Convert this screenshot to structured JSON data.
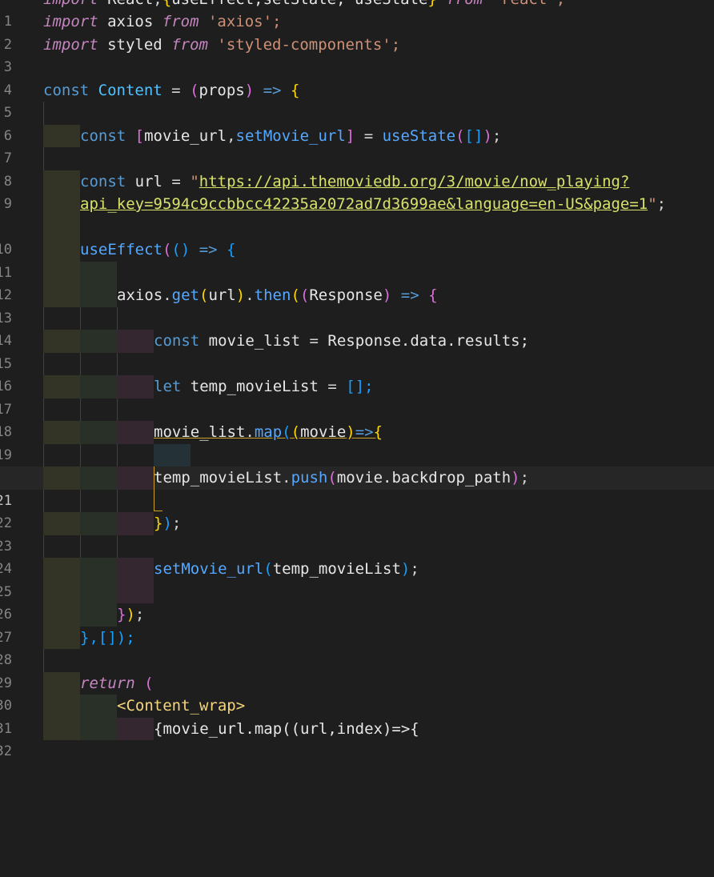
{
  "editor": {
    "line_numbers": [
      "1",
      "2",
      "3",
      "4",
      "5",
      "6",
      "7",
      "8",
      "9",
      "",
      "10",
      "11",
      "12",
      "13",
      "14",
      "15",
      "16",
      "17",
      "18",
      "19",
      "20",
      "21",
      "22",
      "23",
      "24",
      "25",
      "26",
      "27",
      "28",
      "29",
      "30",
      "31",
      "32"
    ],
    "current_line": "21",
    "lines": [
      {
        "import_kw": "import",
        "react_name": "React",
        "open": "{",
        "hooks": "useEffect,setState, useState",
        "close": "}",
        "from_kw": "from",
        "module": "'react';"
      },
      {
        "import_kw": "import",
        "name": "axios",
        "from_kw": "from",
        "module": "'axios';"
      },
      {
        "import_kw": "import",
        "name": "styled",
        "from_kw": "from",
        "module": "'styled-components';"
      },
      {},
      {
        "const_kw": "const",
        "name": "Content",
        "eq": " = ",
        "paren_open": "(",
        "param": "props",
        "paren_close": ")",
        "arrow": " => ",
        "brace": "{"
      },
      {},
      {
        "const_kw": "const",
        "bracket_open": "[",
        "a": "movie_url",
        "comma": ",",
        "b": "setMovie_url",
        "bracket_close": "]",
        "eq": " = ",
        "fn": "useState",
        "p_open": "(",
        "arr": "[]",
        "p_close": ")",
        "semi": ";"
      },
      {},
      {
        "const_kw": "const",
        "name": "url",
        "eq": " = ",
        "quote": "\"",
        "url_part1": "https://api.themoviedb.org/3/movie/now_playing?"
      },
      {
        "url_part2": "api_key=9594c9ccbbcc42235a2072ad7d3699ae&language=en-US&page=1",
        "quote_end": "\"",
        "semi": ";"
      },
      {},
      {
        "fn": "useEffect",
        "p_open": "(",
        "inner": "()",
        "arrow": " => ",
        "brace": "{"
      },
      {},
      {
        "obj": "axios",
        "dot": ".",
        "m1": "get",
        "p_open": "(",
        "arg": "url",
        "p_close": ")",
        "dot2": ".",
        "m2": "then",
        "p2_open": "(",
        "p3_open": "(",
        "param": "Response",
        "p3_close": ")",
        "arrow": " => ",
        "brace": "{"
      },
      {},
      {
        "const_kw": "const",
        "name": "movie_list",
        "eq": " = ",
        "value": "Response.data.results;"
      },
      {},
      {
        "let_kw": "let",
        "name": "temp_movieList",
        "eq": " = ",
        "value": "[];"
      },
      {},
      {
        "obj": "movie_list",
        "dot": ".",
        "m": "map",
        "p_open": "(",
        "p2_open": "(",
        "param": "movie",
        "p2_close": ")",
        "arrow": "=>",
        "brace": "{"
      },
      {},
      {
        "obj": "temp_movieList",
        "dot": ".",
        "m": "push",
        "p_open": "(",
        "arg": "movie.backdrop_path",
        "p_close": ")",
        "semi": ";"
      },
      {},
      {
        "brace": "}",
        "paren": ")",
        "semi": ";"
      },
      {},
      {
        "fn": "setMovie_url",
        "p_open": "(",
        "arg": "temp_movieList",
        "p_close": ")",
        "semi": ";"
      },
      {},
      {
        "brace": "}",
        "paren": ")",
        "semi": ";"
      },
      {
        "text": "},[]);"
      },
      {},
      {
        "kw": "return",
        "paren": " ("
      },
      {
        "tag": "<Content_wrap>"
      },
      {
        "text": "{movie_url.map((url,index)=>{"
      }
    ]
  }
}
